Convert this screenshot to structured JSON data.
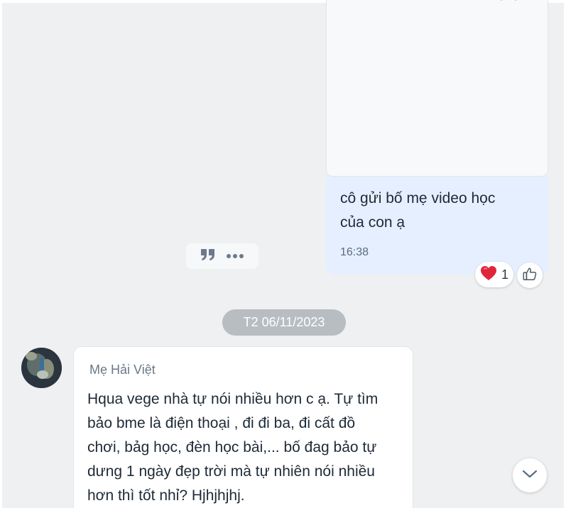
{
  "sent_message": {
    "text_line1": "cô gửi bố mẹ video học",
    "text_line2": "của con ạ",
    "time": "16:38",
    "reactions": [
      {
        "icon": "heart-icon",
        "count": "1"
      }
    ],
    "like_icon": "thumbs-up-icon"
  },
  "hover_actions": {
    "quote_icon": "quote-icon",
    "more_icon": "more-icon"
  },
  "date_divider": "T2 06/11/2023",
  "received_message": {
    "sender": "Mẹ Hải Việt",
    "lines": [
      "Hqua vege nhà tự nói nhiều hơn c ạ. Tự tìm",
      "bảo bme là điện thoại , đi đi ba, đi cất đồ",
      "chơi, bảg học, đèn học bài,... bố đag bảo tự",
      "dưng 1 ngày đẹp trời mà tự nhiên nói nhiều",
      "hơn thì tốt nhỉ? Hjhjhjhj."
    ]
  },
  "scroll_down_icon": "chevron-down-icon",
  "colors": {
    "background": "#eef0f1",
    "sent_bubble": "#e5efff",
    "received_bubble": "#ffffff",
    "date_pill": "#b8bdc2",
    "heart": "#e0263a"
  }
}
